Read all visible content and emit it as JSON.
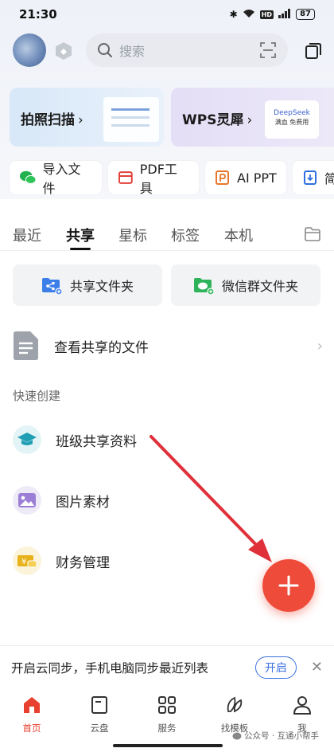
{
  "status_bar": {
    "time": "21:30",
    "battery": "87"
  },
  "header": {
    "search_placeholder": "搜索"
  },
  "banners": {
    "scan": {
      "label": "拍照扫描",
      "chevron": "›"
    },
    "ai": {
      "label": "WPS灵犀",
      "chevron": "›",
      "card_title": "DeepSeek",
      "card_sub": "满血 免费用"
    }
  },
  "tools": [
    {
      "label": "导入文件",
      "icon": "wechat-icon"
    },
    {
      "label": "PDF工具",
      "icon": "pdf-icon"
    },
    {
      "label": "AI PPT",
      "icon": "ppt-icon"
    },
    {
      "label": "简",
      "icon": "doc-icon"
    }
  ],
  "tabs": [
    "最近",
    "共享",
    "星标",
    "标签",
    "本机"
  ],
  "active_tab": "共享",
  "share_buttons": [
    {
      "label": "共享文件夹",
      "icon": "share-folder-icon"
    },
    {
      "label": "微信群文件夹",
      "icon": "wechat-folder-icon"
    }
  ],
  "view_shared": {
    "label": "查看共享的文件"
  },
  "quick_create": {
    "title": "快速创建",
    "items": [
      {
        "label": "班级共享资料",
        "icon": "graduation-cap-icon"
      },
      {
        "label": "图片素材",
        "icon": "image-icon"
      },
      {
        "label": "财务管理",
        "icon": "finance-icon"
      }
    ]
  },
  "sync_bar": {
    "text": "开启云同步，手机电脑同步最近列表",
    "button": "开启",
    "close": "✕"
  },
  "bottom_nav": [
    {
      "label": "首页",
      "icon": "home-icon",
      "active": true
    },
    {
      "label": "云盘",
      "icon": "cloud-drive-icon"
    },
    {
      "label": "服务",
      "icon": "grid-icon"
    },
    {
      "label": "找模板",
      "icon": "leaf-icon"
    },
    {
      "label": "我",
      "icon": "person-icon"
    }
  ],
  "watermark": "公众号 · 互通小帮手",
  "colors": {
    "accent": "#ef4b3a",
    "link_blue": "#3b6fe0",
    "annotation_arrow": "#e0303a"
  }
}
